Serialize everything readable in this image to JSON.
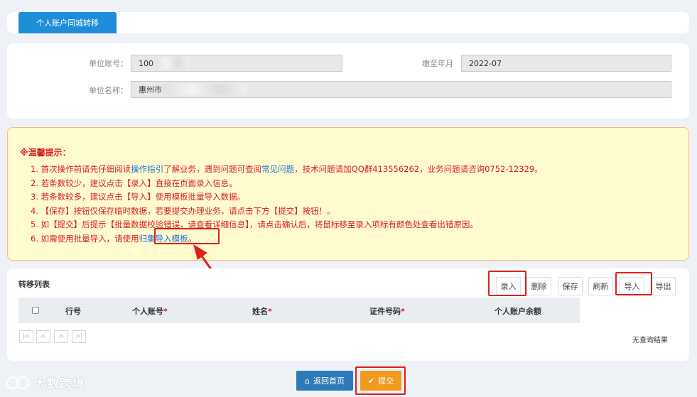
{
  "tab": {
    "label": "个人账户同城转移"
  },
  "form": {
    "unit_account_label": "单位账号：",
    "unit_account_value": "100",
    "paid_until_label": "缴至年月",
    "paid_until_value": "2022-07",
    "unit_name_label": "单位名称：",
    "unit_name_value": "惠州市"
  },
  "tips": {
    "title": "※温馨提示：",
    "line1_a": "1. 首次操作前请先仔细阅读",
    "line1_link1": "操作指引",
    "line1_b": "了解业务，遇到问题可查阅",
    "line1_link2": "常见问题",
    "line1_c": "，技术问题请加QQ群413556262，业务问题请咨询0752-12329。",
    "line2": "2. 若条数较少，建议点击【录入】直接在页面录入信息。",
    "line3": "3. 若条数较多，建议点击【导入】使用模板批量导入数据。",
    "line4": "4. 【保存】按钮仅保存临时数据，若要提交办理业务，请点击下方【提交】按钮！。",
    "line5": "5. 如【提交】后提示【批量数据校验错误，请查看详细信息】，请点击确认后，将鼠标移至录入项标有颜色处查看出错原因。",
    "line6_a": "6. 如需使用批量导入，请使用",
    "line6_link": "归集导入模板",
    "line6_b": "。"
  },
  "list": {
    "title": "转移列表",
    "toolbar": {
      "add": "录入",
      "delete": "删除",
      "save": "保存",
      "refresh": "刷新",
      "import": "导入",
      "export": "导出"
    },
    "columns": {
      "row": "行号",
      "personal_account": "个人账号",
      "name": "姓名",
      "id_number": "证件号码",
      "balance": "个人账户余额",
      "required_mark": "*"
    },
    "pager": {
      "first": "|<",
      "prev": "<",
      "next": ">",
      "last": ">|"
    },
    "empty_text": "无查询结果"
  },
  "actions": {
    "home": "返回首页",
    "submit": "提交"
  },
  "watermark": "大数跨境",
  "colors": {
    "primary": "#1e8ed9",
    "warning_text": "#d61e1e",
    "submit": "#f09a20",
    "home": "#2e7ab9",
    "highlight": "#e01e1e"
  }
}
